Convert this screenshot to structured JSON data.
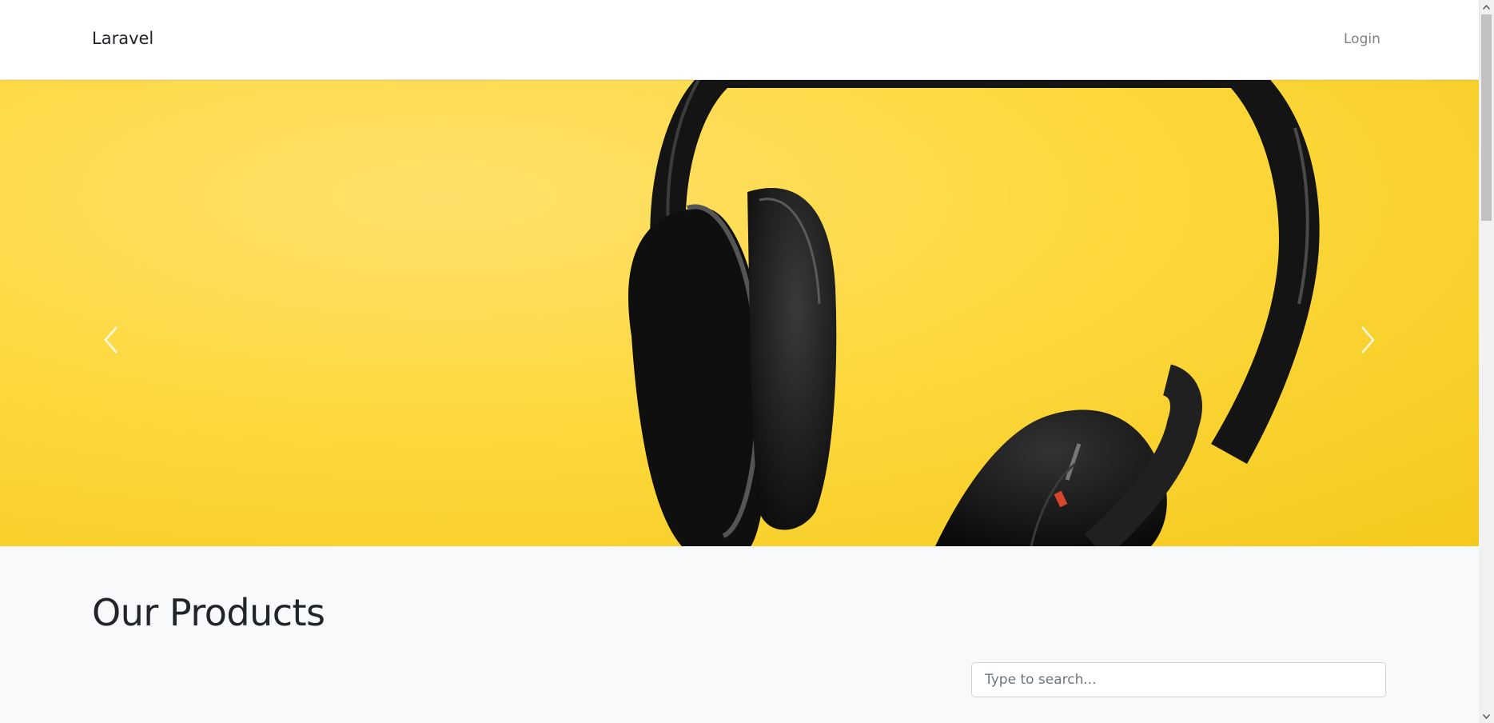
{
  "navbar": {
    "brand": "Laravel",
    "login_label": "Login"
  },
  "carousel": {
    "image_subject": "black headphones on yellow background",
    "prev_icon": "chevron-left-icon",
    "next_icon": "chevron-right-icon",
    "background_color": "#fdd93f"
  },
  "products": {
    "title": "Our Products",
    "search_placeholder": "Type to search..."
  },
  "colors": {
    "navbar_bg": "#ffffff",
    "page_bg": "#f8f9fa",
    "brand_text": "#212529",
    "login_text": "#818181"
  }
}
